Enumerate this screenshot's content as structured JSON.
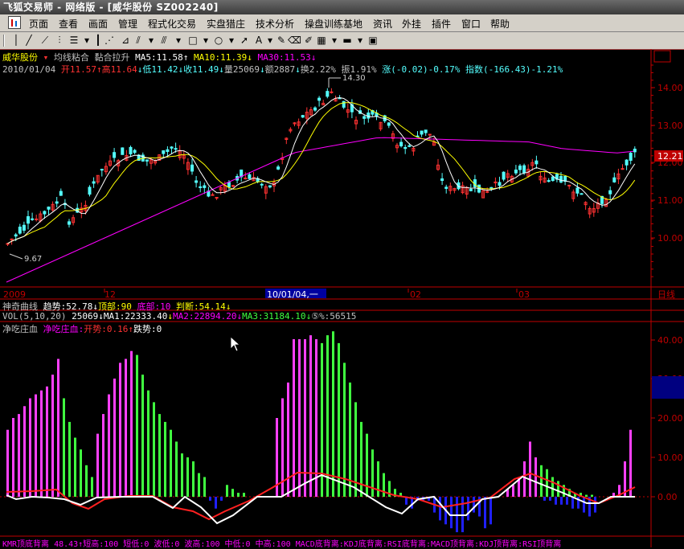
{
  "window": {
    "title": "飞狐交易师 - 网络版 - [威华股份 SZ002240]",
    "menus": [
      "页面",
      "查看",
      "画面",
      "管理",
      "程式化交易",
      "实盘猎庄",
      "技术分析",
      "操盘训练基地",
      "资讯",
      "外挂",
      "插件",
      "窗口",
      "帮助"
    ]
  },
  "header": {
    "stock_name": "威华股份",
    "indicator_title_1": "均线粘合",
    "indicator_title_2": "黏合拉升",
    "ma5": "MA5:11.58",
    "ma10": "MA10:11.39",
    "ma30": "MA30:11.53",
    "date": "2010/01/04",
    "open": "开11.57",
    "high": "高11.64",
    "low": "低11.42",
    "close": "收11.49",
    "volume": "量25069",
    "amount": "额2887",
    "turnover": "换2.22%",
    "amplitude": "振1.91%",
    "change": "涨(-0.02)-0.17%",
    "index": "指数(-166.43)-1.21%"
  },
  "main_chart": {
    "price_labels": [
      "14.00",
      "13.00",
      "12.00",
      "11.00",
      "10.00"
    ],
    "current_price": "12.21",
    "peak_label": "14.30",
    "trough_label": "9.67",
    "time_labels": [
      "2009",
      "12",
      "02",
      "03"
    ],
    "cursor_date": "10/01/04,一",
    "period_label": "日线"
  },
  "sub1": {
    "title": "神奇曲线",
    "trend": "趋势:52.78",
    "top": "顶部:90",
    "bottom": "底部:10",
    "judge": "判断:54.14"
  },
  "sub2": {
    "title": "VOL(5,10,20)",
    "vol": "25069",
    "ma1": "MA1:22333.40",
    "ma2": "MA2:22894.20",
    "ma3": "MA3:31184.10",
    "extra": "%:56515"
  },
  "sub3": {
    "title": "净吃庄血",
    "name": "净吃庄血:",
    "open_trend": "开势:0.16",
    "fall_trend": "跌势:0",
    "axis_labels": [
      "40.00",
      "30.00",
      "20.00",
      "10.00",
      "0.00"
    ]
  },
  "bottom_bar": {
    "text": "KMR顶底背离 48.43↑短高:100 短低:0 波低:0 波高:100 中低:0 中高:100 MACD底背离:KDJ底背离:RSI底背离:MACD顶背离:KDJ顶背离:RSI顶背离"
  },
  "colors": {
    "up": "#ff3232",
    "down": "#54ffff",
    "ma5": "#ffffff",
    "ma10": "#ffff00",
    "ma30": "#ff00ff",
    "grid": "#800000",
    "axis": "#c00000",
    "green_bar": "#40ff40",
    "magenta_bar": "#ff40ff",
    "blue_bar": "#2020ff"
  }
}
